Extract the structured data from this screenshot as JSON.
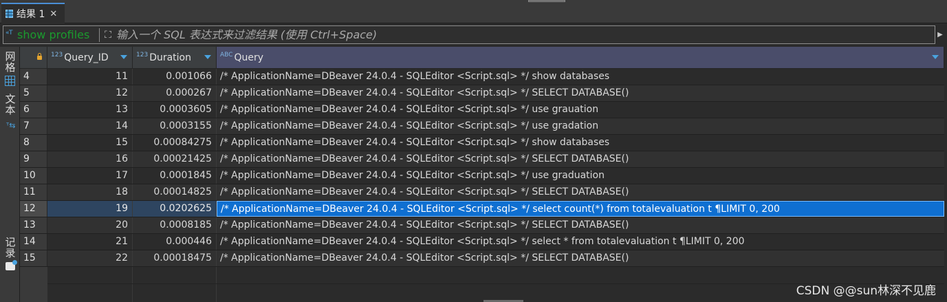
{
  "tab": {
    "label": "结果 1",
    "close": "✕"
  },
  "filter": {
    "history_text": "show profiles",
    "placeholder": "输入一个 SQL 表达式来过滤结果 (使用 Ctrl+Space)",
    "run_glyph": "▶",
    "expand_glyph": "⛶",
    "tag_glyph": "«T"
  },
  "side_tabs": {
    "grid": [
      "网",
      "格"
    ],
    "text": [
      "文",
      "本"
    ],
    "record": [
      "记",
      "录"
    ]
  },
  "columns": [
    {
      "type": "123",
      "name": "Query_ID"
    },
    {
      "type": "123",
      "name": "Duration"
    },
    {
      "type": "ABC",
      "name": "Query"
    }
  ],
  "rows": [
    {
      "num": "4",
      "id": "11",
      "dur": "0.001066",
      "query": "/* ApplicationName=DBeaver 24.0.4 - SQLEditor <Script.sql> */ show databases"
    },
    {
      "num": "5",
      "id": "12",
      "dur": "0.000267",
      "query": "/* ApplicationName=DBeaver 24.0.4 - SQLEditor <Script.sql> */ SELECT DATABASE()"
    },
    {
      "num": "6",
      "id": "13",
      "dur": "0.0003605",
      "query": "/* ApplicationName=DBeaver 24.0.4 - SQLEditor <Script.sql> */ use grauation"
    },
    {
      "num": "7",
      "id": "14",
      "dur": "0.0003155",
      "query": "/* ApplicationName=DBeaver 24.0.4 - SQLEditor <Script.sql> */ use gradation"
    },
    {
      "num": "8",
      "id": "15",
      "dur": "0.00084275",
      "query": "/* ApplicationName=DBeaver 24.0.4 - SQLEditor <Script.sql> */ show databases"
    },
    {
      "num": "9",
      "id": "16",
      "dur": "0.00021425",
      "query": "/* ApplicationName=DBeaver 24.0.4 - SQLEditor <Script.sql> */ SELECT DATABASE()"
    },
    {
      "num": "10",
      "id": "17",
      "dur": "0.0001845",
      "query": "/* ApplicationName=DBeaver 24.0.4 - SQLEditor <Script.sql> */ use graduation"
    },
    {
      "num": "11",
      "id": "18",
      "dur": "0.00014825",
      "query": "/* ApplicationName=DBeaver 24.0.4 - SQLEditor <Script.sql> */ SELECT DATABASE()"
    },
    {
      "num": "12",
      "id": "19",
      "dur": "0.0202625",
      "query": "/* ApplicationName=DBeaver 24.0.4 - SQLEditor <Script.sql> */ select count(*) from totalevaluation t ¶LIMIT 0, 200"
    },
    {
      "num": "13",
      "id": "20",
      "dur": "0.0008185",
      "query": "/* ApplicationName=DBeaver 24.0.4 - SQLEditor <Script.sql> */ SELECT DATABASE()"
    },
    {
      "num": "14",
      "id": "21",
      "dur": "0.000446",
      "query": "/* ApplicationName=DBeaver 24.0.4 - SQLEditor <Script.sql> */ select * from totalevaluation t ¶LIMIT 0, 200"
    },
    {
      "num": "15",
      "id": "22",
      "dur": "0.00018475",
      "query": "/* ApplicationName=DBeaver 24.0.4 - SQLEditor <Script.sql> */ SELECT DATABASE()"
    }
  ],
  "selected_row_index": 8,
  "watermark": "CSDN @@sun林深不见鹿"
}
